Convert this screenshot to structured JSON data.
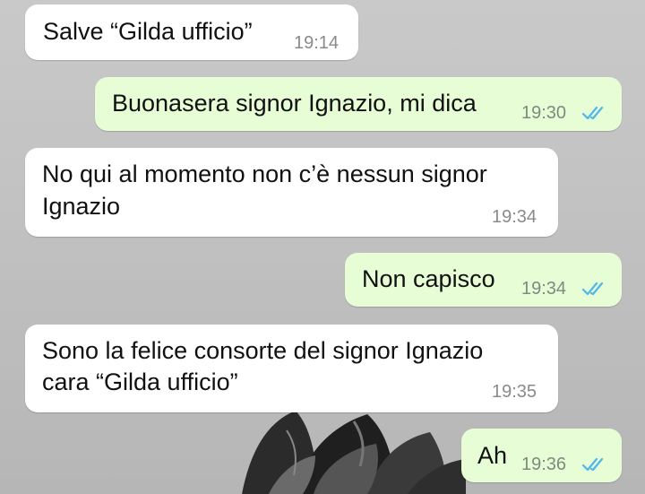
{
  "chat": {
    "messages": [
      {
        "direction": "incoming",
        "text": "Salve “Gilda ufficio”",
        "time": "19:14"
      },
      {
        "direction": "outgoing",
        "text": "Buonasera signor Ignazio, mi dica",
        "time": "19:30",
        "status": "read"
      },
      {
        "direction": "incoming",
        "lines": [
          "No qui al momento non c’è nessun signor",
          "Ignazio"
        ],
        "time": "19:34"
      },
      {
        "direction": "outgoing",
        "text": "Non capisco",
        "time": "19:34",
        "status": "read"
      },
      {
        "direction": "incoming",
        "lines": [
          "Sono la felice consorte del signor Ignazio",
          "cara “Gilda ufficio”"
        ],
        "time": "19:35"
      },
      {
        "direction": "outgoing",
        "text": "Ah",
        "time": "19:36",
        "status": "read"
      }
    ]
  },
  "colors": {
    "incoming_bubble": "#ffffff",
    "outgoing_bubble": "#e7fdd6",
    "read_ticks": "#4fb6ec"
  },
  "icons": {
    "read_receipt": "double-check-icon",
    "wallpaper": "dark-flower-wallpaper"
  }
}
